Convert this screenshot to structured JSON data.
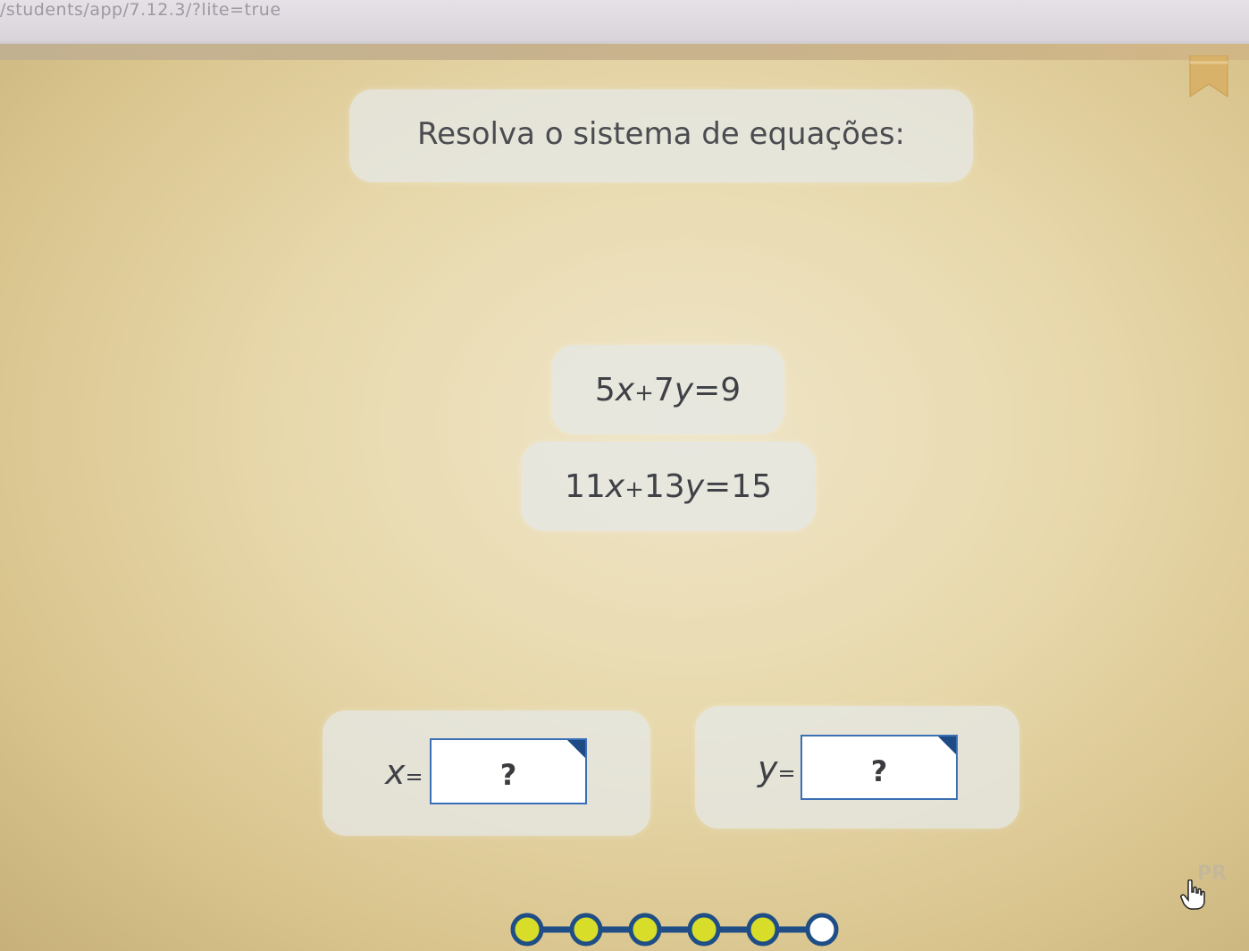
{
  "browser": {
    "url_fragment": "/students/app/7.12.3/?lite=true"
  },
  "exercise": {
    "instruction": "Resolva o sistema de equações:",
    "equations": [
      {
        "a": "5",
        "x": "x",
        "op1": "+",
        "b": "7",
        "y": "y",
        "eq": "=",
        "c": "9"
      },
      {
        "a": "11",
        "x": "x",
        "op1": "+",
        "b": "13",
        "y": "y",
        "eq": "=",
        "c": "15"
      }
    ]
  },
  "answers": {
    "x": {
      "label": "x",
      "eq": "=",
      "placeholder": "?"
    },
    "y": {
      "label": "y",
      "eq": "=",
      "placeholder": "?"
    }
  },
  "progress": {
    "total_steps": 6,
    "completed_steps": 5,
    "color_done": "#d8dd2a",
    "color_pending": "#ffffff",
    "color_line": "#1f4e86"
  },
  "next_hint_text": "PR",
  "colors": {
    "panel": "#e6e8e6",
    "input_border": "#3a6fb5",
    "input_corner": "#1e4a86"
  }
}
